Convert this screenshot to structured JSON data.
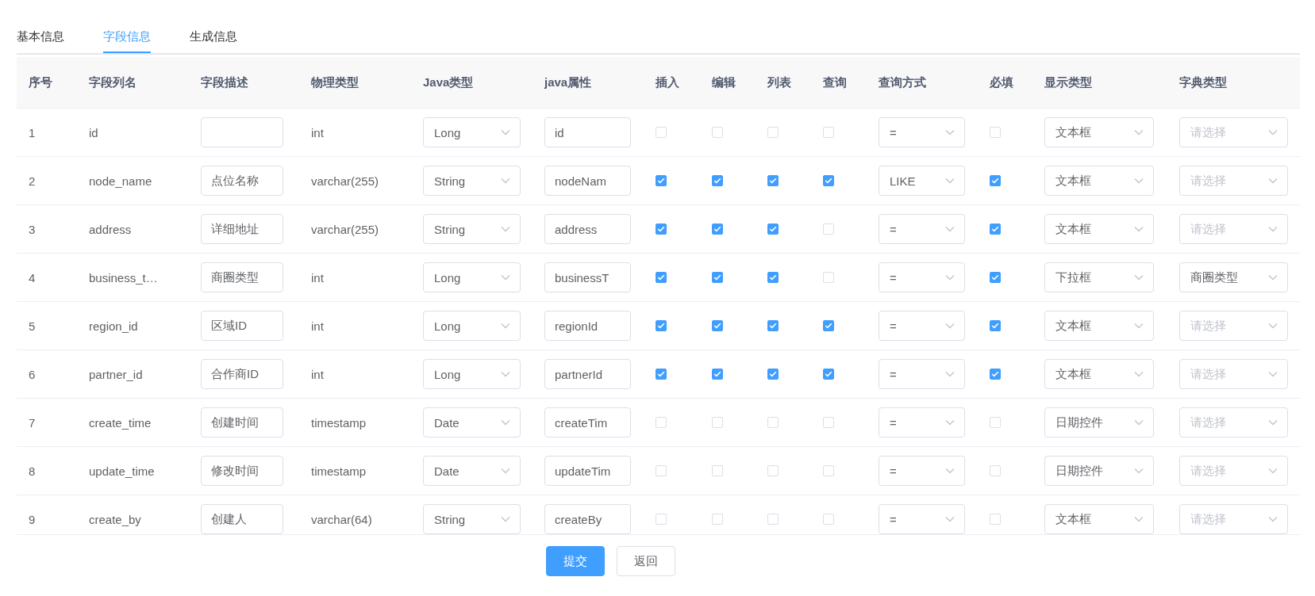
{
  "tabs": [
    {
      "label": "基本信息",
      "selected": false
    },
    {
      "label": "字段信息",
      "selected": true
    },
    {
      "label": "生成信息",
      "selected": false
    }
  ],
  "table": {
    "columns": [
      "序号",
      "字段列名",
      "字段描述",
      "物理类型",
      "Java类型",
      "java属性",
      "插入",
      "编辑",
      "列表",
      "查询",
      "查询方式",
      "必填",
      "显示类型",
      "字典类型"
    ],
    "rows": [
      {
        "number": "1",
        "column_name": "id",
        "description": {},
        "physical_type": "int",
        "java_type": "Long",
        "java_field": "id",
        "insert": false,
        "edit": false,
        "list": false,
        "query": false,
        "query_type": "=",
        "required": false,
        "display_type": "文本框",
        "dict_type": {
          "placeholder": "请选择"
        }
      },
      {
        "number": "2",
        "column_name": "node_name",
        "description": {
          "value": "点位名称"
        },
        "physical_type": "varchar(255)",
        "java_type": "String",
        "java_field": "nodeNam",
        "insert": true,
        "edit": true,
        "list": true,
        "query": true,
        "query_type": "LIKE",
        "required": true,
        "display_type": "文本框",
        "dict_type": {
          "placeholder": "请选择"
        }
      },
      {
        "number": "3",
        "column_name": "address",
        "description": {
          "value": "详细地址"
        },
        "physical_type": "varchar(255)",
        "java_type": "String",
        "java_field": "address",
        "insert": true,
        "edit": true,
        "list": true,
        "query": false,
        "query_type": "=",
        "required": true,
        "display_type": "文本框",
        "dict_type": {
          "placeholder": "请选择"
        }
      },
      {
        "number": "4",
        "column_name": "business_t…",
        "description": {
          "value": "商圈类型"
        },
        "physical_type": "int",
        "java_type": "Long",
        "java_field": "businessT",
        "insert": true,
        "edit": true,
        "list": true,
        "query": false,
        "query_type": "=",
        "required": true,
        "display_type": "下拉框",
        "dict_type": {
          "value": "商圈类型"
        }
      },
      {
        "number": "5",
        "column_name": "region_id",
        "description": {
          "value": "区域ID"
        },
        "physical_type": "int",
        "java_type": "Long",
        "java_field": "regionId",
        "insert": true,
        "edit": true,
        "list": true,
        "query": true,
        "query_type": "=",
        "required": true,
        "display_type": "文本框",
        "dict_type": {
          "placeholder": "请选择"
        }
      },
      {
        "number": "6",
        "column_name": "partner_id",
        "description": {
          "value": "合作商ID"
        },
        "physical_type": "int",
        "java_type": "Long",
        "java_field": "partnerId",
        "insert": true,
        "edit": true,
        "list": true,
        "query": true,
        "query_type": "=",
        "required": true,
        "display_type": "文本框",
        "dict_type": {
          "placeholder": "请选择"
        }
      },
      {
        "number": "7",
        "column_name": "create_time",
        "description": {
          "value": "创建时间"
        },
        "physical_type": "timestamp",
        "java_type": "Date",
        "java_field": "createTim",
        "insert": false,
        "edit": false,
        "list": false,
        "query": false,
        "query_type": "=",
        "required": false,
        "display_type": "日期控件",
        "dict_type": {
          "placeholder": "请选择"
        }
      },
      {
        "number": "8",
        "column_name": "update_time",
        "description": {
          "value": "修改时间"
        },
        "physical_type": "timestamp",
        "java_type": "Date",
        "java_field": "updateTim",
        "insert": false,
        "edit": false,
        "list": false,
        "query": false,
        "query_type": "=",
        "required": false,
        "display_type": "日期控件",
        "dict_type": {
          "placeholder": "请选择"
        }
      },
      {
        "number": "9",
        "column_name": "create_by",
        "description": {
          "value": "创建人"
        },
        "physical_type": "varchar(64)",
        "java_type": "String",
        "java_field": "createBy",
        "insert": false,
        "edit": false,
        "list": false,
        "query": false,
        "query_type": "=",
        "required": false,
        "display_type": "文本框",
        "dict_type": {
          "placeholder": "请选择"
        }
      }
    ]
  },
  "buttons": [
    {
      "label": "提交",
      "kind": "primary"
    },
    {
      "label": "返回",
      "kind": "default"
    }
  ]
}
